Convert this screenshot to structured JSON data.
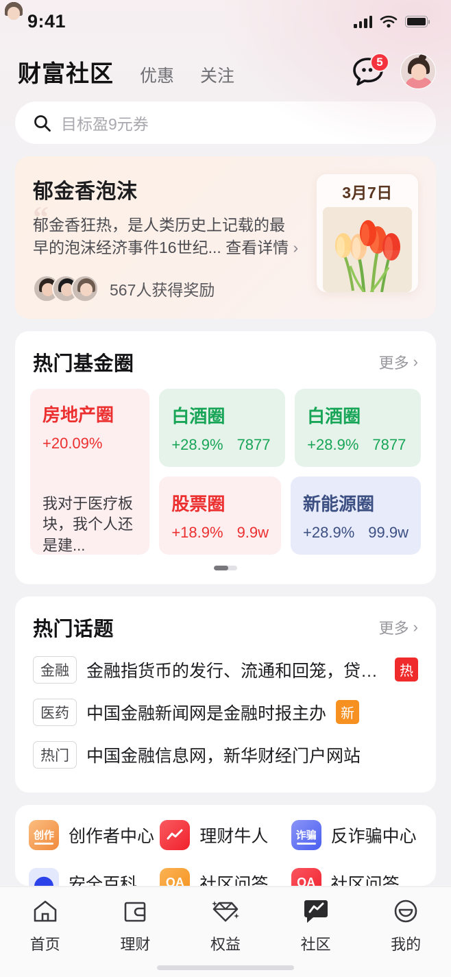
{
  "status_bar": {
    "time": "9:41",
    "signal_icon": "cellular-signal-icon",
    "wifi_icon": "wifi-icon",
    "battery_icon": "battery-icon"
  },
  "header": {
    "tabs": [
      {
        "label": "财富社区",
        "active": true
      },
      {
        "label": "优惠",
        "active": false
      },
      {
        "label": "关注",
        "active": false
      }
    ],
    "message_icon": "chat-bubble-icon",
    "message_badge": "5",
    "avatar_label": "user-avatar"
  },
  "search": {
    "placeholder": "目标盈9元券",
    "icon": "search-icon"
  },
  "banner": {
    "title": "郁金香泡沫",
    "quote_mark": "“",
    "description": "郁金香狂热，是人类历史上记载的最早的泡沫经济事件16世纪...",
    "detail_link": "查看详情",
    "chevron": "›",
    "reward_text": "567人获得奖励",
    "date": "3月7日",
    "image_label": "tulips-photo"
  },
  "fund_circles": {
    "title": "热门基金圈",
    "more_label": "更多",
    "chevron": "›",
    "cards": [
      {
        "name": "房地产圈",
        "change": "+20.09%",
        "members": "",
        "quote": "我对于医疗板块，我个人还是建...",
        "theme": "red",
        "size": "large"
      },
      {
        "name": "白酒圈",
        "change": "+28.9%",
        "members": "7877",
        "theme": "green",
        "size": "small"
      },
      {
        "name": "白酒圈",
        "change": "+28.9%",
        "members": "7877",
        "theme": "green",
        "size": "small"
      },
      {
        "name": "股票圈",
        "change": "+18.9%",
        "members": "9.9w",
        "theme": "red",
        "size": "small"
      },
      {
        "name": "新能源圈",
        "change": "+28.9%",
        "members": "99.9w",
        "theme": "blue",
        "size": "small"
      }
    ],
    "pagination": "page-indicator"
  },
  "hot_topics": {
    "title": "热门话题",
    "more_label": "更多",
    "chevron": "›",
    "items": [
      {
        "tag": "金融",
        "text": "金融指货币的发行、流通和回笼，贷款的...",
        "badge": "热",
        "badge_type": "hot"
      },
      {
        "tag": "医药",
        "text": "中国金融新闻网是金融时报主办",
        "badge": "新",
        "badge_type": "new"
      },
      {
        "tag": "热门",
        "text": "中国金融信息网，新华财经门户网站",
        "badge": "",
        "badge_type": ""
      }
    ]
  },
  "quick_entries": {
    "items": [
      {
        "label": "创作者中心",
        "icon_text": "创作",
        "icon_name": "creator-center-icon",
        "color": "#f08a3c",
        "bg": "#fdece0"
      },
      {
        "label": "理财牛人",
        "icon_text": "",
        "icon_name": "finance-expert-chart-icon",
        "color": "#f2363c",
        "bg": "#fde9ea"
      },
      {
        "label": "反诈骗中心",
        "icon_text": "诈骗",
        "icon_name": "anti-fraud-icon",
        "color": "#4a5ef0",
        "bg": "#e6e9fd"
      },
      {
        "label": "安全百科",
        "icon_text": "",
        "icon_name": "safety-encyclopedia-icon",
        "color": "#2b43e8",
        "bg": "#e4e8fd"
      },
      {
        "label": "社区问答",
        "icon_text": "QA",
        "icon_name": "community-qa-orange-icon",
        "color": "#f5921e",
        "bg": "#fdeddb"
      },
      {
        "label": "社区问答",
        "icon_text": "QA",
        "icon_name": "community-qa-red-icon",
        "color": "#f02b37",
        "bg": "#fde6e8"
      }
    ]
  },
  "tabbar": {
    "items": [
      {
        "label": "首页",
        "icon": "home-icon",
        "active": false
      },
      {
        "label": "理财",
        "icon": "wallet-icon",
        "active": false
      },
      {
        "label": "权益",
        "icon": "diamond-icon",
        "active": false
      },
      {
        "label": "社区",
        "icon": "community-chat-chart-icon",
        "active": true
      },
      {
        "label": "我的",
        "icon": "profile-smiley-icon",
        "active": false
      }
    ]
  },
  "colors": {
    "accent_red": "#ec2f2f",
    "accent_green": "#18a558",
    "accent_blue": "#3c4f82",
    "badge_red": "#f5333f",
    "badge_orange": "#f59021",
    "page_bg": "#f2f2f4"
  }
}
